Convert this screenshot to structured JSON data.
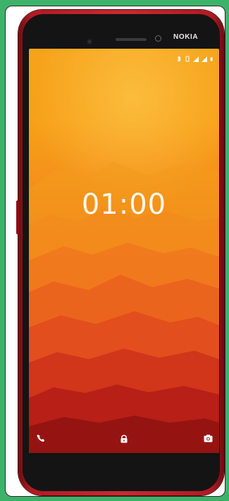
{
  "device": {
    "brand": "NOKIA",
    "body_color": "#c92a33",
    "frame_color": "#3db36a"
  },
  "lockscreen": {
    "time": "01:00",
    "status_icons": [
      "bluetooth-icon",
      "vibrate-icon",
      "signal-icon",
      "signal-icon-2",
      "battery-icon"
    ],
    "shortcuts": {
      "left": "phone-icon",
      "center": "lock-icon",
      "right": "camera-icon"
    }
  }
}
